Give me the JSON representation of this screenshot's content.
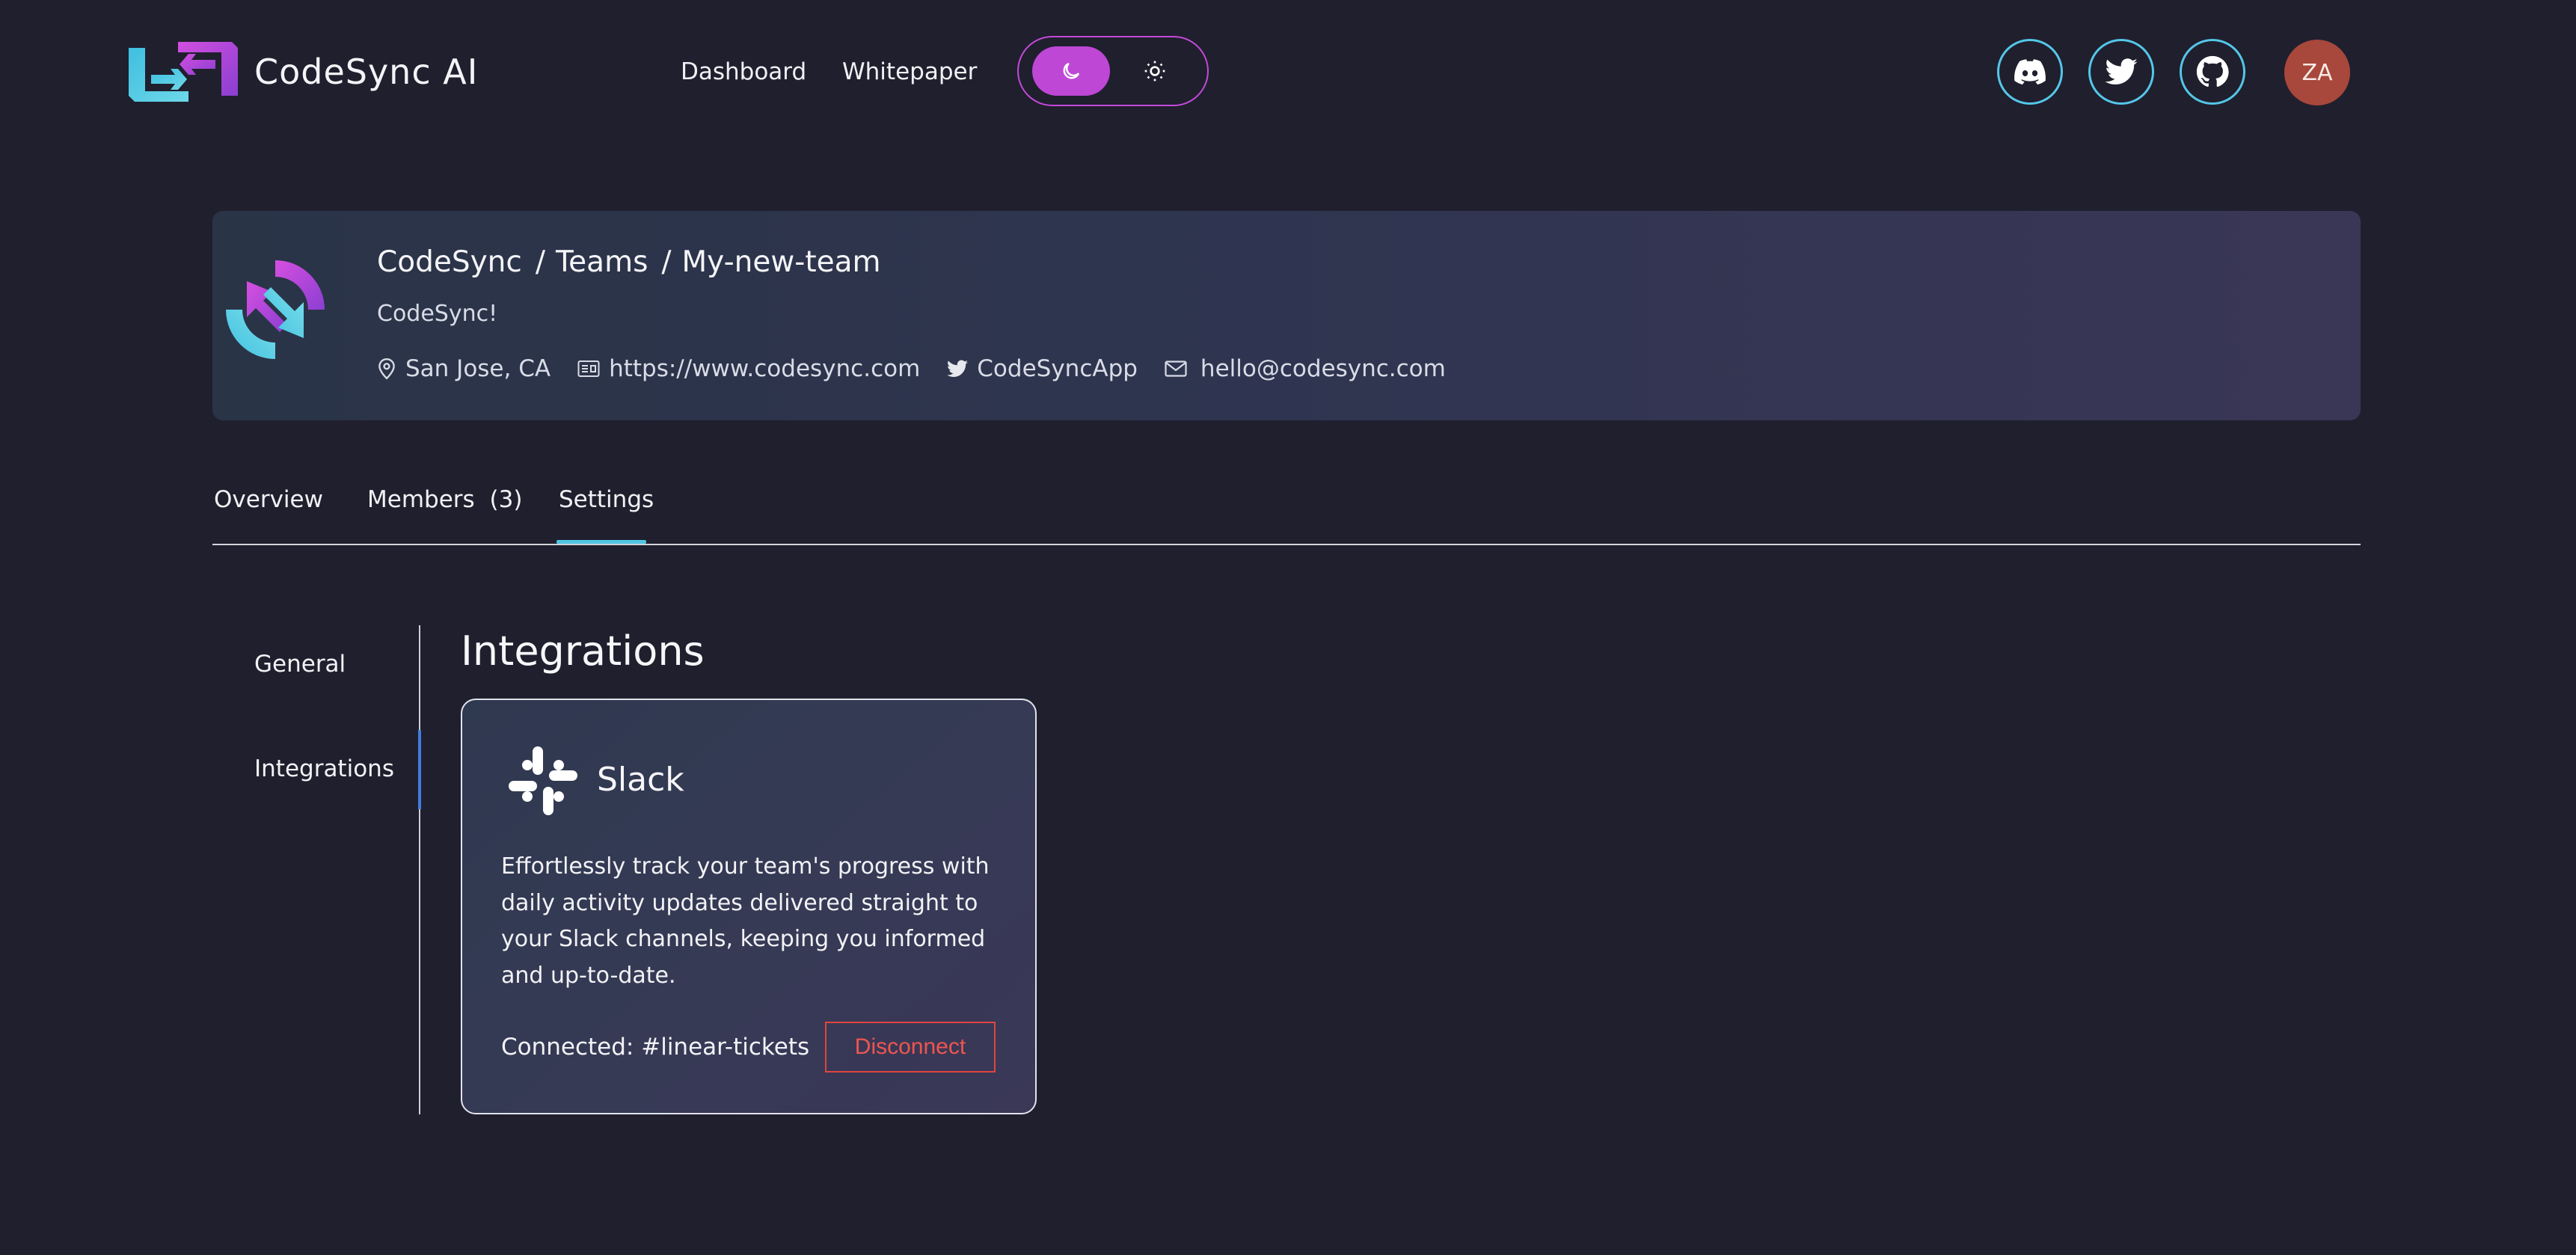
{
  "brand": {
    "name": "CodeSync AI"
  },
  "nav": {
    "dashboard": "Dashboard",
    "whitepaper": "Whitepaper"
  },
  "theme": {
    "active": "dark",
    "toggle_color": "#bf47d6"
  },
  "social": {
    "icons": [
      "discord-icon",
      "twitter-icon",
      "github-icon"
    ],
    "ring_color": "#54c7e8"
  },
  "user": {
    "initials": "ZA",
    "avatar_color": "#a8473b"
  },
  "team": {
    "breadcrumb": [
      "CodeSync",
      "Teams",
      "My-new-team"
    ],
    "separator": "/",
    "tagline": "CodeSync!",
    "location": "San Jose, CA",
    "website": "https://www.codesync.com",
    "twitter": "CodeSyncApp",
    "email": "hello@codesync.com"
  },
  "tabs": {
    "overview": "Overview",
    "members": "Members",
    "members_count": "(3)",
    "settings": "Settings",
    "active": "Settings",
    "accent": "#4fc6e3"
  },
  "settings_nav": {
    "general": "General",
    "integrations": "Integrations",
    "active": "Integrations"
  },
  "integrations": {
    "title": "Integrations",
    "slack": {
      "name": "Slack",
      "description": "Effortlessly track your team's progress with daily activity updates delivered straight to your Slack channels, keeping you informed and up-to-date.",
      "connected": "Connected: #linear-tickets",
      "disconnect_label": "Disconnect",
      "danger_color": "#e0443f"
    }
  }
}
